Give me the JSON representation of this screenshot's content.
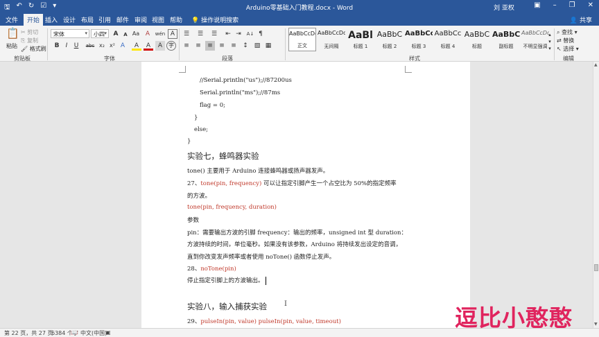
{
  "titlebar": {
    "title": "Arduino零基础入门教程.docx - Word",
    "user": "刘 亚权",
    "qat_icons": [
      "save-icon",
      "undo-icon",
      "redo-icon",
      "check-icon",
      "customize-icon"
    ],
    "window_icons": [
      "ribbon-display-icon",
      "minimize-icon",
      "restore-icon",
      "close-icon"
    ]
  },
  "tabs": {
    "items": [
      "文件",
      "开始",
      "插入",
      "设计",
      "布局",
      "引用",
      "邮件",
      "审阅",
      "视图",
      "帮助"
    ],
    "active": "开始",
    "tell_me": "操作说明搜索",
    "share": "共享"
  },
  "ribbon": {
    "clipboard": {
      "paste": "粘贴",
      "cut": "剪切",
      "copy": "复制",
      "format_painter": "格式刷",
      "label": "剪贴板"
    },
    "font": {
      "name": "宋体",
      "size": "小四",
      "label": "字体",
      "bold": "B",
      "italic": "I",
      "underline": "U",
      "strike": "abc",
      "subscript": "x₂",
      "superscript": "x²",
      "grow": "A",
      "shrink": "A",
      "change_case": "Aa",
      "clear": "A",
      "phonetic": "wén",
      "border": "A",
      "highlight": "A",
      "font_color": "A",
      "shading": "A",
      "enclose": "字"
    },
    "paragraph": {
      "label": "段落",
      "sort": "A↓",
      "marks": "¶"
    },
    "styles": {
      "label": "样式",
      "items": [
        {
          "sample": "AaBbCcDd",
          "name": "正文",
          "selected": true
        },
        {
          "sample": "AaBbCcDd",
          "name": "无间隔",
          "selected": false
        },
        {
          "sample": "AaBl",
          "name": "标题 1",
          "selected": false
        },
        {
          "sample": "AaBbC",
          "name": "标题 2",
          "selected": false
        },
        {
          "sample": "AaBbCc",
          "name": "标题 3",
          "selected": false
        },
        {
          "sample": "AaBbCc",
          "name": "标题 4",
          "selected": false
        },
        {
          "sample": "AaBbC",
          "name": "标题",
          "selected": false
        },
        {
          "sample": "AaBbC",
          "name": "副标题",
          "selected": false
        },
        {
          "sample": "AaBbCcDd",
          "name": "不明显强调",
          "selected": false
        }
      ]
    },
    "editing": {
      "label": "编辑",
      "find": "查找",
      "replace": "替换",
      "select": "选择"
    }
  },
  "document": {
    "lines": [
      {
        "text": "//Serial.println(\"us\");//87200us",
        "red": ""
      },
      {
        "text": "Serial.println(\"ms\");//87ms",
        "red": ""
      },
      {
        "text": "flag = 0;",
        "red": ""
      },
      {
        "text": "}",
        "red": ""
      },
      {
        "text": "else;",
        "red": ""
      },
      {
        "text": "}",
        "red": ""
      },
      {
        "text": "实验七，蜂鸣器实验",
        "red": ""
      },
      {
        "text": "tone() 主要用于 Arduino 连接蜂鸣器或扬声器发声。",
        "red": ""
      },
      {
        "prefix": "27、",
        "red": "tone(pin, frequency)",
        "text": " 可以让指定引脚产生一个占空比为 50%的指定频率"
      },
      {
        "text": "的方波。",
        "red": ""
      },
      {
        "text": "",
        "red": "tone(pin, frequency, duration)"
      },
      {
        "text": "参数",
        "red": ""
      },
      {
        "text": "pin：需要输出方波的引脚 frequency：输出的频率，unsigned int 型 duration：",
        "red": ""
      },
      {
        "text": "方波持续的时间，单位毫秒。如果没有该参数，Arduino 将持续发出设定的音调，",
        "red": ""
      },
      {
        "text": "直到你改变发声频率或者使用 noTone() 函数停止发声。",
        "red": ""
      },
      {
        "prefix": "28、",
        "red": "noTone(pin)",
        "text": ""
      },
      {
        "text": "停止指定引脚上的方波输出。",
        "red": ""
      },
      {
        "text": "实验八，输入捕获实验",
        "red": ""
      },
      {
        "prefix": "29、",
        "red": "pulseIn(pin, value) pulseIn(pin, value, timeout)",
        "text": ""
      }
    ]
  },
  "status": {
    "page": "第 22 页，共 27 页",
    "words": "6384 个字",
    "language": "中文(中国)"
  },
  "watermark": "逗比小憨憨",
  "colors": {
    "brand": "#2b579a",
    "code_red": "#c0392b",
    "watermark": "#e0245e"
  }
}
